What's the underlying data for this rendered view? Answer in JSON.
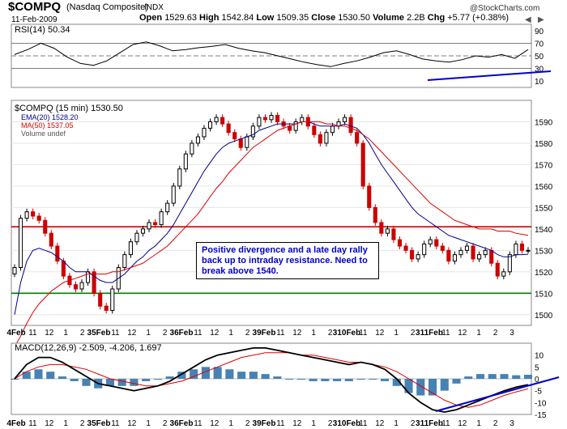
{
  "header": {
    "symbol": "$COMPQ",
    "name": "(Nasdaq Composite)",
    "exchange": "INDX",
    "date": "11-Feb-2009",
    "open_label": "Open",
    "open": "1529.63",
    "high_label": "High",
    "high": "1542.84",
    "low_label": "Low",
    "low": "1509.35",
    "close_label": "Close",
    "close": "1530.50",
    "volume_label": "Volume",
    "volume": "2.2B",
    "chg_label": "Chg",
    "chg": "+5.77 (+0.38%)",
    "brand": "@StockCharts.com",
    "arrow_left": "◀",
    "arrow_right": "▶"
  },
  "annotation": "Positive divergence  and a late day rally back up to intraday resistance.  Need to break above 1540.",
  "colors": {
    "up": "#000000",
    "down": "#cc0000",
    "ema": "#00008b",
    "ma": "#e00000",
    "support": "#008000",
    "resistance": "#cc0000",
    "trend": "#0000cc",
    "histogram": "#4682b4"
  },
  "chart_data": [
    {
      "type": "line",
      "title": "RSI(14) 50.34",
      "ylim": [
        0,
        100
      ],
      "y_ticks": [
        "90",
        "70",
        "50",
        "30",
        "10"
      ],
      "levels": [
        70,
        50,
        30
      ],
      "series": [
        {
          "name": "RSI(14)",
          "values": [
            52,
            60,
            70,
            62,
            48,
            38,
            35,
            42,
            55,
            68,
            72,
            66,
            58,
            60,
            63,
            65,
            68,
            62,
            58,
            55,
            50,
            45,
            40,
            36,
            33,
            38,
            42,
            48,
            55,
            58,
            52,
            45,
            42,
            40,
            44,
            50,
            48,
            52,
            46,
            60
          ]
        }
      ]
    },
    {
      "type": "bar",
      "subtype": "candlestick",
      "title": "$COMPQ (15 min) 1530.50",
      "legend": [
        "EMA(20) 1528.20",
        "MA(50) 1537.05",
        "Volume undef"
      ],
      "ylim": [
        1495,
        1600
      ],
      "y_ticks": [
        "1590",
        "1580",
        "1570",
        "1560",
        "1550",
        "1540",
        "1530",
        "1520",
        "1510",
        "1500"
      ],
      "x_labels": [
        "4Feb",
        "11",
        "12",
        "1",
        "2",
        "35Feb",
        "11",
        "12",
        "1",
        "2",
        "36Feb",
        "11",
        "12",
        "1",
        "2",
        "39Feb",
        "11",
        "12",
        "1",
        "2",
        "310Feb",
        "11",
        "12",
        "1",
        "2",
        "311Feb",
        "11",
        "12",
        "1",
        "2",
        "3"
      ],
      "x_label_days": [
        "4Feb",
        "5Feb",
        "6Feb",
        "9Feb",
        "10Feb",
        "11Feb"
      ],
      "resistance": 1541,
      "support": 1510,
      "close_series": [
        1522,
        1545,
        1548,
        1546,
        1544,
        1538,
        1532,
        1525,
        1518,
        1514,
        1512,
        1515,
        1520,
        1510,
        1504,
        1502,
        1512,
        1522,
        1528,
        1534,
        1538,
        1540,
        1543,
        1542,
        1548,
        1552,
        1560,
        1568,
        1575,
        1580,
        1583,
        1587,
        1590,
        1592,
        1589,
        1585,
        1582,
        1578,
        1583,
        1588,
        1592,
        1591,
        1593,
        1590,
        1588,
        1586,
        1590,
        1592,
        1588,
        1584,
        1580,
        1585,
        1588,
        1590,
        1592,
        1585,
        1580,
        1560,
        1550,
        1543,
        1538,
        1540,
        1535,
        1532,
        1530,
        1526,
        1528,
        1533,
        1535,
        1532,
        1530,
        1525,
        1528,
        1530,
        1532,
        1526,
        1528,
        1530,
        1524,
        1518,
        1520,
        1528,
        1533,
        1530,
        1530
      ],
      "series": [
        {
          "name": "EMA(20)",
          "values": [
            1500,
            1515,
            1525,
            1530,
            1531,
            1530,
            1529,
            1527,
            1525,
            1522,
            1520,
            1520,
            1520,
            1518,
            1516,
            1515,
            1515,
            1517,
            1519,
            1522,
            1525,
            1527,
            1530,
            1532,
            1535,
            1538,
            1542,
            1547,
            1552,
            1557,
            1562,
            1567,
            1571,
            1575,
            1578,
            1580,
            1581,
            1582,
            1583,
            1584,
            1586,
            1587,
            1588,
            1589,
            1589,
            1589,
            1589,
            1590,
            1590,
            1589,
            1588,
            1588,
            1588,
            1588,
            1589,
            1588,
            1587,
            1584,
            1580,
            1575,
            1570,
            1566,
            1562,
            1558,
            1554,
            1550,
            1547,
            1545,
            1543,
            1541,
            1539,
            1537,
            1536,
            1535,
            1534,
            1533,
            1532,
            1531,
            1530,
            1528,
            1527,
            1527,
            1528,
            1528,
            1528.2
          ]
        },
        {
          "name": "MA(50)",
          "values": [
            1485,
            1490,
            1496,
            1501,
            1505,
            1508,
            1511,
            1513,
            1515,
            1516,
            1517,
            1518,
            1519,
            1519,
            1519,
            1519,
            1520,
            1520,
            1521,
            1522,
            1523,
            1524,
            1526,
            1528,
            1530,
            1532,
            1535,
            1538,
            1541,
            1544,
            1547,
            1551,
            1555,
            1559,
            1562,
            1566,
            1569,
            1572,
            1575,
            1578,
            1580,
            1582,
            1584,
            1586,
            1587,
            1588,
            1589,
            1590,
            1590,
            1590,
            1590,
            1589,
            1589,
            1588,
            1588,
            1587,
            1586,
            1584,
            1582,
            1579,
            1576,
            1573,
            1570,
            1567,
            1564,
            1561,
            1558,
            1555,
            1552,
            1550,
            1548,
            1546,
            1544,
            1543,
            1542,
            1541,
            1540,
            1540,
            1540,
            1539,
            1539,
            1539,
            1538,
            1537.5,
            1537.05
          ]
        }
      ]
    },
    {
      "type": "line",
      "title": "MACD(12,26,9) -2.509, -4.206, 1.697",
      "ylim": [
        -15,
        15
      ],
      "y_ticks": [
        "10",
        "5",
        "0",
        "-5",
        "-10",
        "-15"
      ],
      "series": [
        {
          "name": "MACD(12,26,9)",
          "values": [
            0,
            6,
            9,
            9,
            7,
            4,
            1,
            -2,
            -3,
            -4,
            -5,
            -4,
            -3,
            -1,
            2,
            5,
            8,
            10,
            11,
            12,
            13,
            13,
            12,
            11,
            10,
            9,
            8,
            7,
            6,
            7,
            6,
            4,
            0,
            -6,
            -10,
            -13,
            -14,
            -13,
            -11,
            -9,
            -7,
            -5,
            -3.5,
            -2.5
          ]
        },
        {
          "name": "Signal",
          "values": [
            0,
            3,
            5,
            6,
            6,
            5,
            4,
            2,
            0,
            -1,
            -2,
            -3,
            -3,
            -2,
            -1,
            1,
            3,
            5,
            7,
            9,
            10,
            11,
            11,
            11,
            10,
            10,
            9,
            8,
            7,
            7,
            6,
            5,
            3,
            0,
            -3,
            -6,
            -9,
            -11,
            -12,
            -11,
            -9,
            -7,
            -5.5,
            -4.2
          ]
        },
        {
          "name": "Histogram",
          "values": [
            0,
            3,
            4,
            3,
            1,
            -1,
            -3,
            -4,
            -3,
            -3,
            -3,
            -1,
            0,
            1,
            3,
            4,
            5,
            5,
            4,
            3,
            3,
            2,
            1,
            0,
            0,
            -1,
            -1,
            -1,
            -1,
            0,
            0,
            -1,
            -3,
            -6,
            -7,
            -7,
            -5,
            -2,
            1,
            2,
            2,
            2,
            1.5,
            1.7
          ]
        }
      ]
    }
  ]
}
